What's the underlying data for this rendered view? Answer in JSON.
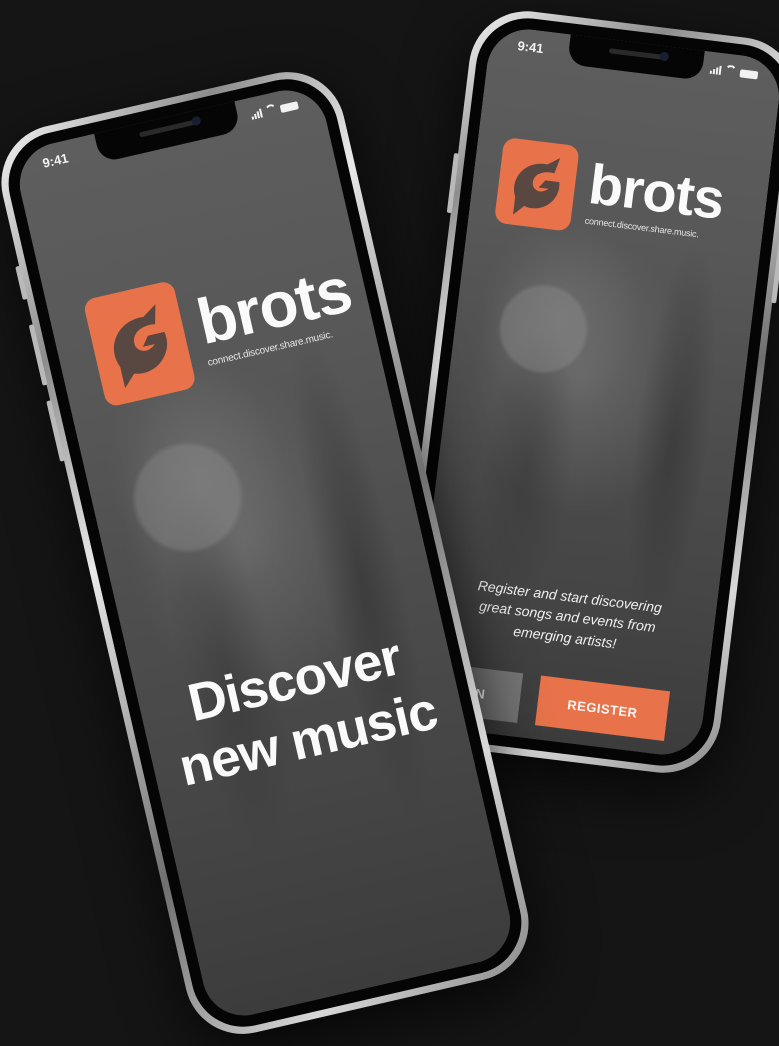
{
  "status_bar": {
    "time": "9:41"
  },
  "brand": {
    "name": "brots",
    "tagline": "connect.discover.share.music.",
    "accent_color": "#e8734a",
    "logo_icon": "brots-logo-icon"
  },
  "front_phone": {
    "headline_line1": "Discover",
    "headline_line2": "new music"
  },
  "back_phone": {
    "blurb_line1": "Register and start discovering",
    "blurb_line2": "great songs and events from",
    "blurb_line3": "emerging artists!",
    "login_label": "N",
    "register_label": "REGISTER"
  }
}
